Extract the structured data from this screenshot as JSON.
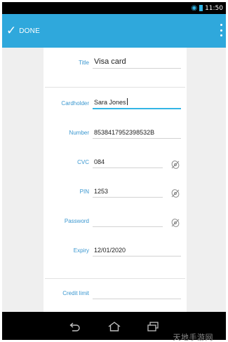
{
  "status_bar": {
    "time": "11:50"
  },
  "action_bar": {
    "done_label": "DONE"
  },
  "form": {
    "title": {
      "label": "Title",
      "value": "Visa card"
    },
    "cardholder": {
      "label": "Cardholder",
      "value": "Sara Jones"
    },
    "number": {
      "label": "Number",
      "value": "8538417952398532B"
    },
    "cvc": {
      "label": "CVC",
      "value": "084"
    },
    "pin": {
      "label": "PIN",
      "value": "1253"
    },
    "password": {
      "label": "Password",
      "value": ""
    },
    "expiry": {
      "label": "Expiry",
      "value": "12/01/2020"
    },
    "credit_limit": {
      "label": "Credit limit",
      "value": ""
    }
  },
  "watermark": "天地手游网",
  "icons": {
    "accent": "#2fa8dc",
    "label_color": "#3a97d0"
  }
}
